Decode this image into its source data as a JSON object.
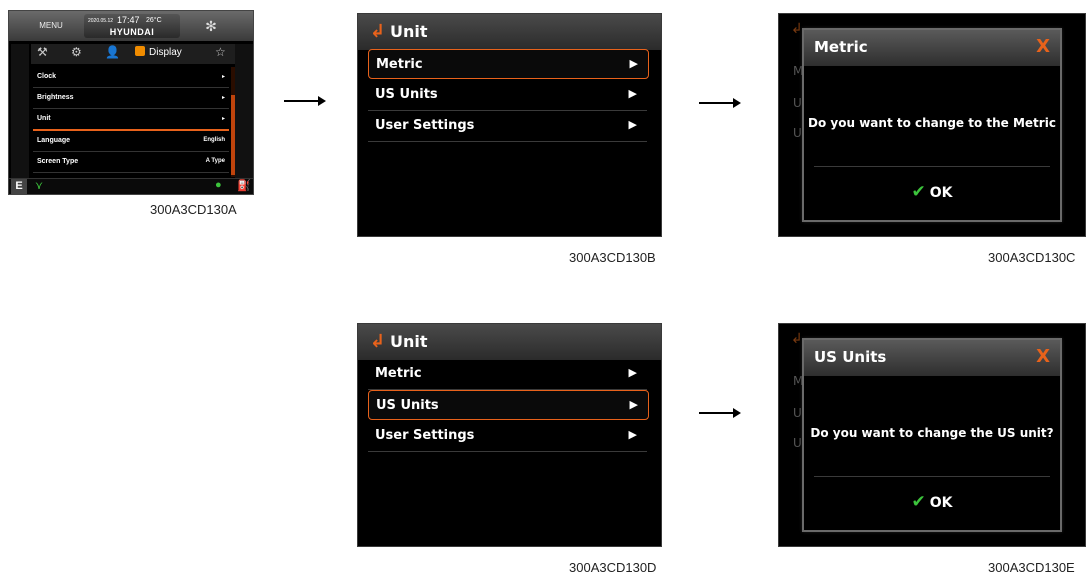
{
  "screen_a": {
    "menu_label": "MENU",
    "date": "2020.05.12",
    "time": "17:47",
    "temperature": "26°C",
    "brand": "HYUNDAI",
    "tab_label": "Display",
    "rows": [
      {
        "label": "Clock",
        "value": "▸"
      },
      {
        "label": "Brightness",
        "value": "▸"
      },
      {
        "label": "Unit",
        "value": "▸"
      },
      {
        "label": "Language",
        "value": "English"
      },
      {
        "label": "Screen Type",
        "value": "A Type"
      }
    ],
    "mode": "E",
    "caption": "300A3CD130A"
  },
  "screen_b": {
    "title": "Unit",
    "items": [
      "Metric",
      "US Units",
      "User Settings"
    ],
    "caption": "300A3CD130B"
  },
  "screen_c": {
    "dialog_title": "Metric",
    "close": "X",
    "message": "Do you want to change to the Metric",
    "ok": "OK",
    "caption": "300A3CD130C"
  },
  "screen_d": {
    "title": "Unit",
    "items": [
      "Metric",
      "US Units",
      "User Settings"
    ],
    "caption": "300A3CD130D"
  },
  "screen_e": {
    "dialog_title": "US Units",
    "close": "X",
    "message": "Do you want to change the US unit?",
    "ok": "OK",
    "caption": "300A3CD130E"
  },
  "colors": {
    "accent": "#e8621b",
    "check": "#3cc43c",
    "screen_bg": "#000000"
  }
}
